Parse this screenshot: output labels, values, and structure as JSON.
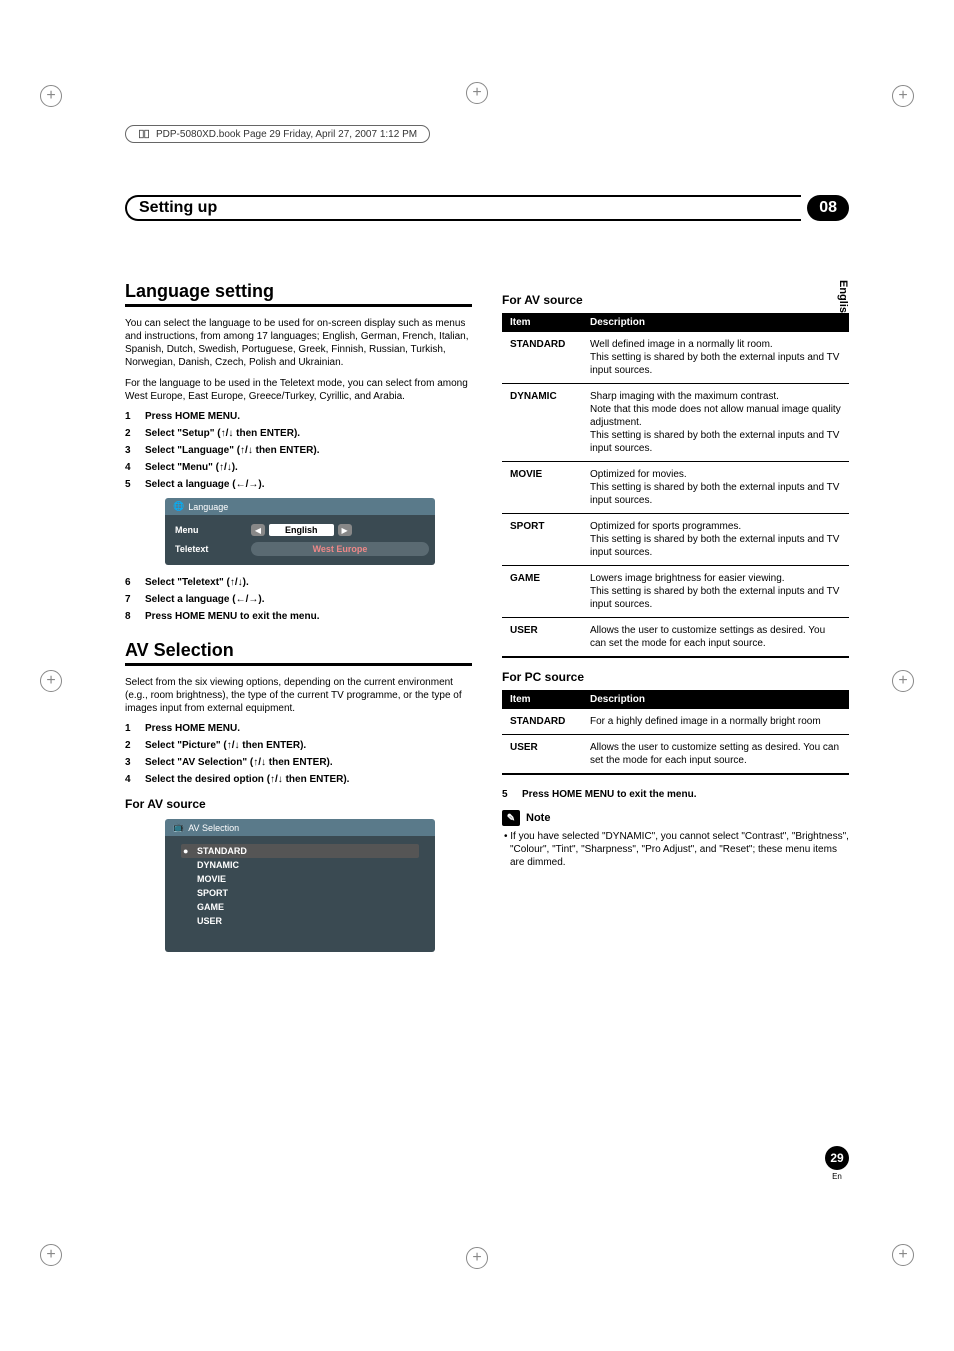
{
  "book_header": "PDP-5080XD.book  Page 29  Friday, April 27, 2007  1:12 PM",
  "chapter": {
    "title": "Setting up",
    "number": "08"
  },
  "side_tab": "English",
  "page": {
    "number": "29",
    "lang": "En"
  },
  "left": {
    "lang_section_title": "Language setting",
    "lang_intro1": "You can select the language to be used for on-screen display such as menus and instructions, from among 17 languages; English, German, French, Italian, Spanish, Dutch, Swedish, Portuguese, Greek, Finnish, Russian, Turkish, Norwegian, Danish, Czech, Polish and Ukrainian.",
    "lang_intro2": "For the language to be used in the Teletext mode, you can select from among West Europe, East Europe, Greece/Turkey, Cyrillic, and Arabia.",
    "lang_steps": [
      "Press HOME MENU.",
      "Select \"Setup\" (↑/↓ then ENTER).",
      "Select \"Language\" (↑/↓ then ENTER).",
      "Select \"Menu\" (↑/↓).",
      "Select a language (←/→)."
    ],
    "lang_panel": {
      "title": "Language",
      "row1_label": "Menu",
      "row1_value": "English",
      "row2_label": "Teletext",
      "row2_value": "West Europe"
    },
    "lang_steps2": [
      {
        "n": "6",
        "t": "Select \"Teletext\" (↑/↓)."
      },
      {
        "n": "7",
        "t": "Select a language (←/→)."
      },
      {
        "n": "8",
        "t": "Press HOME MENU to exit the menu."
      }
    ],
    "av_section_title": "AV Selection",
    "av_intro": "Select from the six viewing options, depending on the current environment (e.g., room brightness), the type of the current TV programme, or the type of images input from external equipment.",
    "av_steps": [
      "Press HOME MENU.",
      "Select \"Picture\" (↑/↓ then ENTER).",
      "Select \"AV Selection\" (↑/↓ then ENTER).",
      "Select the desired option (↑/↓ then ENTER)."
    ],
    "av_subsection": "For AV source",
    "av_panel": {
      "title": "AV Selection",
      "items": [
        "STANDARD",
        "DYNAMIC",
        "MOVIE",
        "SPORT",
        "GAME",
        "USER"
      ]
    }
  },
  "right": {
    "av_table_title": "For AV source",
    "av_table_headers": [
      "Item",
      "Description"
    ],
    "av_table_rows": [
      [
        "STANDARD",
        "Well defined image in a normally lit room.\nThis setting is shared by both the external inputs and TV input sources."
      ],
      [
        "DYNAMIC",
        "Sharp imaging with the maximum contrast.\nNote that this mode does not allow manual image quality adjustment.\nThis setting is shared by both the external inputs and TV input sources."
      ],
      [
        "MOVIE",
        "Optimized for movies.\nThis setting is shared by both the external inputs and TV input sources."
      ],
      [
        "SPORT",
        "Optimized for sports programmes.\nThis setting is shared by both the external inputs and TV input sources."
      ],
      [
        "GAME",
        "Lowers image brightness for easier viewing.\nThis setting is shared by both the external inputs and TV input sources."
      ],
      [
        "USER",
        "Allows the user to customize settings as desired. You can set the mode for each input source."
      ]
    ],
    "pc_table_title": "For PC source",
    "pc_table_headers": [
      "Item",
      "Description"
    ],
    "pc_table_rows": [
      [
        "STANDARD",
        "For a highly defined image in a normally bright room"
      ],
      [
        "USER",
        "Allows the user to customize setting as desired. You can set the mode for each input source."
      ]
    ],
    "step5": {
      "n": "5",
      "t": "Press HOME MENU to exit the menu."
    },
    "note_label": "Note",
    "note_text": "• If you have selected \"DYNAMIC\", you cannot select \"Contrast\", \"Brightness\", \"Colour\", \"Tint\", \"Sharpness\", \"Pro Adjust\", and \"Reset\"; these menu items are dimmed."
  }
}
